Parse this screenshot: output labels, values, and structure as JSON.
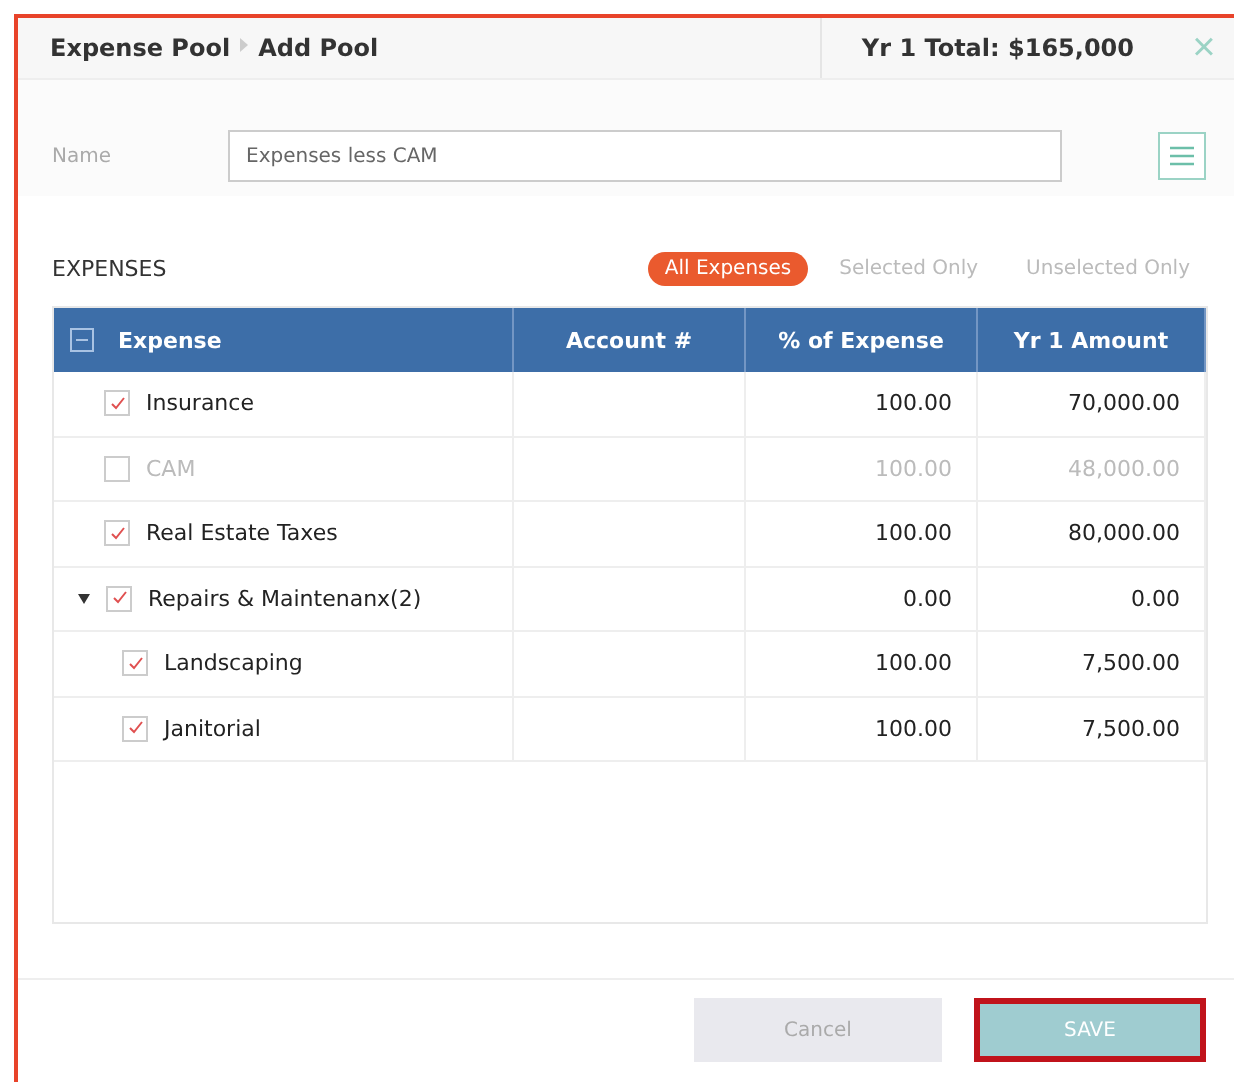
{
  "header": {
    "breadcrumb": [
      "Expense Pool",
      "Add Pool"
    ],
    "total": "Yr 1 Total: $165,000",
    "close": "×"
  },
  "name_field": {
    "label": "Name",
    "value": "Expenses less CAM"
  },
  "section_title": "EXPENSES",
  "filters": [
    {
      "label": "All Expenses",
      "selected": true
    },
    {
      "label": "Selected Only",
      "selected": false
    },
    {
      "label": "Unselected Only",
      "selected": false
    }
  ],
  "table": {
    "columns": [
      "Expense",
      "Account #",
      "% of Expense",
      "Yr 1 Amount"
    ],
    "rows": [
      {
        "expense": "Insurance",
        "percent": "100.00",
        "amount": "70,000.00",
        "checked": true
      },
      {
        "expense": "CAM",
        "percent": "100.00",
        "amount": "48,000.00",
        "checked": false
      },
      {
        "expense": "Real Estate Taxes",
        "percent": "100.00",
        "amount": "80,000.00",
        "checked": true
      },
      {
        "expense": "Repairs & Maintenanx(2)",
        "percent": "0.00",
        "amount": "0.00",
        "checked": true,
        "expanded": true,
        "children": [
          {
            "expense": "Landscaping",
            "percent": "100.00",
            "amount": "7,500.00",
            "checked": true
          },
          {
            "expense": "Janitorial",
            "percent": "100.00",
            "amount": "7,500.00",
            "checked": true
          }
        ]
      }
    ]
  },
  "buttons": [
    {
      "label": "Cancel",
      "kind": "secondary"
    },
    {
      "label": "SAVE",
      "kind": "primary"
    }
  ]
}
